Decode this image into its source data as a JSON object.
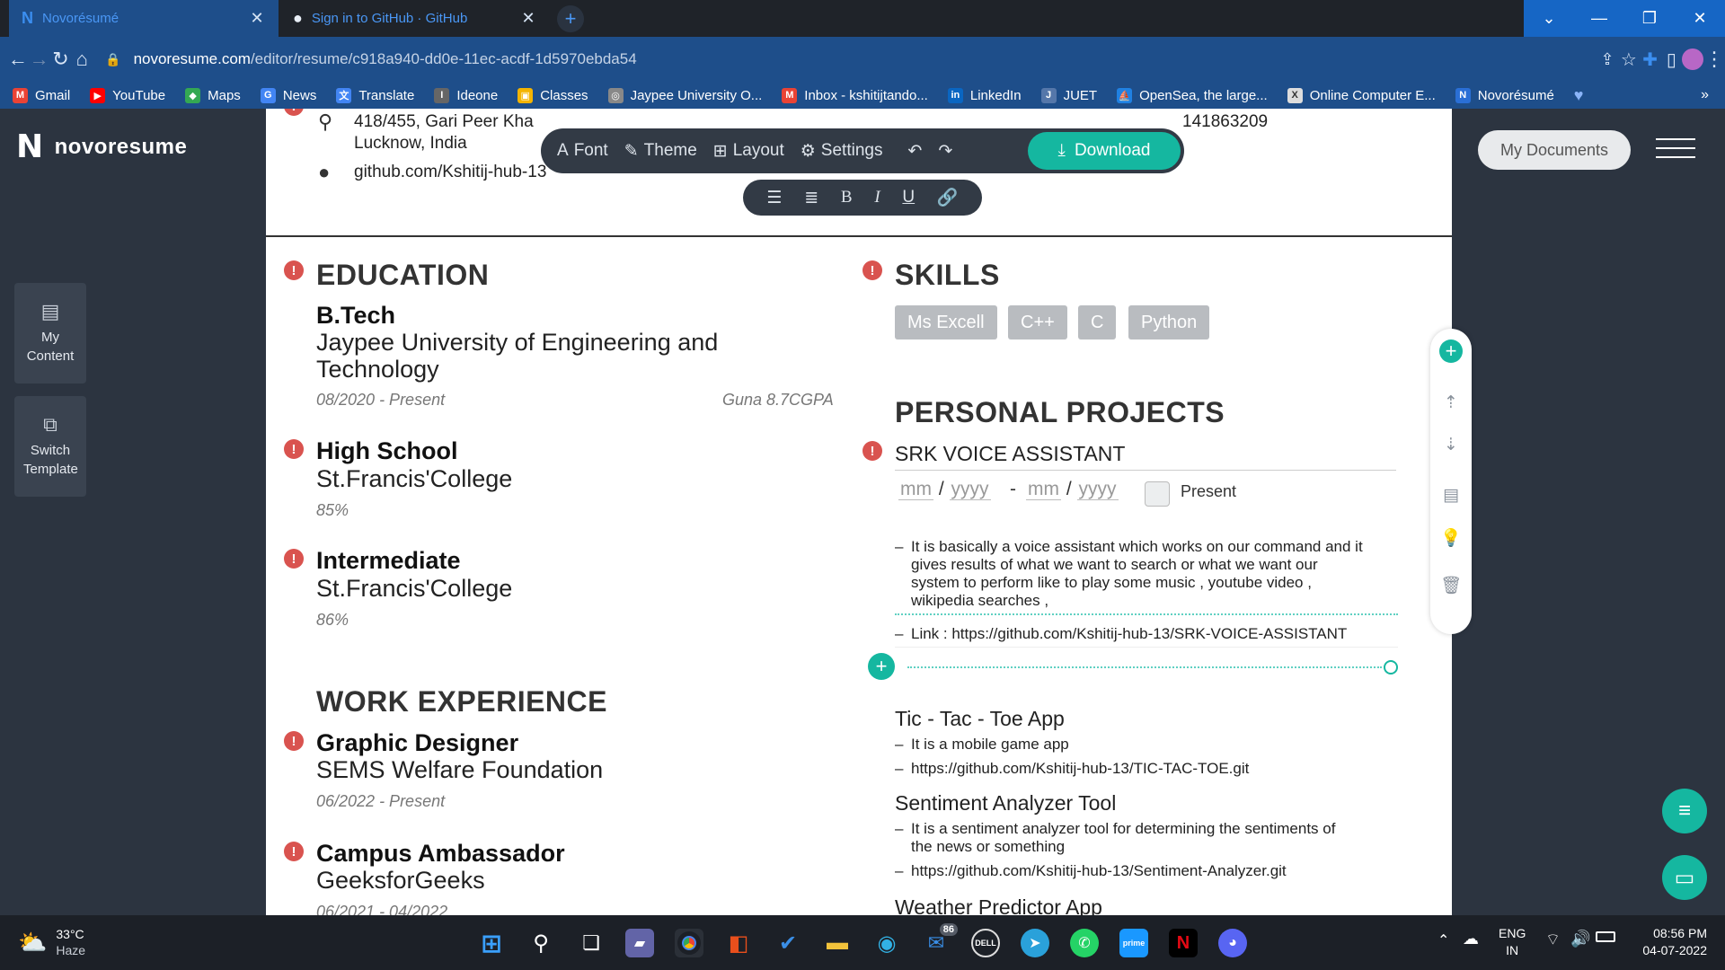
{
  "browser": {
    "tabs": [
      {
        "title": "Novorésumé",
        "icon": "novoresume-icon"
      },
      {
        "title": "Sign in to GitHub · GitHub",
        "icon": "github-icon"
      }
    ],
    "new_tab": "+",
    "url_host": "novoresume.com",
    "url_path": "/editor/resume/c918a940-dd0e-11ec-acdf-1d5970ebda54",
    "bookmarks": [
      {
        "label": "Gmail",
        "color": "#ea4335",
        "glyph": "M"
      },
      {
        "label": "YouTube",
        "color": "#ff0000",
        "glyph": "▶"
      },
      {
        "label": "Maps",
        "color": "#34a853",
        "glyph": "◆"
      },
      {
        "label": "News",
        "color": "#4285f4",
        "glyph": "G"
      },
      {
        "label": "Translate",
        "color": "#4285f4",
        "glyph": "文"
      },
      {
        "label": "Ideone",
        "color": "#666666",
        "glyph": "I"
      },
      {
        "label": "Classes",
        "color": "#f4b400",
        "glyph": "▣"
      },
      {
        "label": "Jaypee University O...",
        "color": "#888888",
        "glyph": "◎"
      },
      {
        "label": "Inbox - kshitijtando...",
        "color": "#ea4335",
        "glyph": "M"
      },
      {
        "label": "LinkedIn",
        "color": "#0a66c2",
        "glyph": "in"
      },
      {
        "label": "JUET",
        "color": "#5577aa",
        "glyph": "J"
      },
      {
        "label": "OpenSea, the large...",
        "color": "#2081e2",
        "glyph": "⛵"
      },
      {
        "label": "Online Computer E...",
        "color": "#dddddd",
        "glyph": "X"
      },
      {
        "label": "Novorésumé",
        "color": "#2a6fd6",
        "glyph": "N"
      }
    ]
  },
  "app": {
    "logo": "novoresume",
    "side": {
      "my_content": "My Content",
      "switch_template": "Switch Template"
    },
    "toolbar": {
      "font": "Font",
      "theme": "Theme",
      "layout": "Layout",
      "settings": "Settings",
      "download": "Download"
    },
    "my_documents": "My Documents"
  },
  "resume": {
    "contact": {
      "address_line1": "418/455, Gari Peer Kha",
      "address_line2": "Lucknow, India",
      "phone": "141863209",
      "github": "github.com/Kshitij-hub-13"
    },
    "education": {
      "heading": "EDUCATION",
      "items": [
        {
          "title": "B.Tech",
          "org_line1": "Jaypee University of Engineering and",
          "org_line2": "Technology",
          "dates": "08/2020 - Present",
          "extra": "Guna 8.7CGPA"
        },
        {
          "title": "High School",
          "org_line1": "St.Francis'College",
          "dates": "85%"
        },
        {
          "title": "Intermediate",
          "org_line1": "St.Francis'College",
          "dates": "86%"
        }
      ]
    },
    "work": {
      "heading": "WORK EXPERIENCE",
      "items": [
        {
          "title": "Graphic Designer",
          "org": "SEMS Welfare Foundation",
          "dates": "06/2022 - Present"
        },
        {
          "title": "Campus Ambassador",
          "org": "GeeksforGeeks",
          "dates": "06/2021 - 04/2022"
        }
      ]
    },
    "skills": {
      "heading": "SKILLS",
      "items": [
        "Ms Excell",
        "C++",
        "C",
        "Python"
      ]
    },
    "projects": {
      "heading": "PERSONAL PROJECTS",
      "active": {
        "title": "SRK VOICE ASSISTANT",
        "mm": "mm",
        "yyyy": "yyyy",
        "sep": "/",
        "dash": "-",
        "present_label": "Present",
        "bullet1": [
          "It is basically a voice assistant which works on our command and it",
          "gives results of what we want to search or what we want our",
          "system to perform like to play some music , youtube video ,",
          "wikipedia searches ,"
        ],
        "bullet2": "Link : https://github.com/Kshitij-hub-13/SRK-VOICE-ASSISTANT"
      },
      "items": [
        {
          "title": "Tic - Tac - Toe App",
          "bullets": [
            "It is a mobile game app",
            "https://github.com/Kshitij-hub-13/TIC-TAC-TOE.git"
          ]
        },
        {
          "title": "Sentiment Analyzer Tool",
          "bullets": [
            "It is a sentiment analyzer tool for determining the sentiments of",
            "the news or something",
            "https://github.com/Kshitij-hub-13/Sentiment-Analyzer.git"
          ]
        },
        {
          "title": "Weather Predictor App"
        }
      ]
    }
  },
  "taskbar": {
    "weather_temp": "33°C",
    "weather_desc": "Haze",
    "mail_badge": "86",
    "lang1": "ENG",
    "lang2": "IN",
    "time": "08:56 PM",
    "date": "04-07-2022"
  }
}
